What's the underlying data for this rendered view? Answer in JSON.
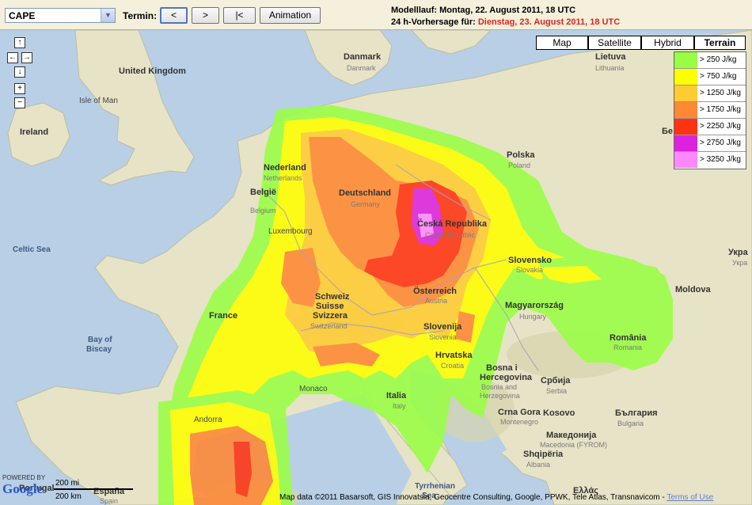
{
  "toolbar": {
    "parameter_select": "CAPE",
    "termin_label": "Termin:",
    "btn_prev": "<",
    "btn_next": ">",
    "btn_first": "|<",
    "btn_animation": "Animation",
    "modelllauf": "Modelllauf: Montag, 22. August 2011, 18 UTC",
    "vorhersage_prefix": "24 h-Vorhersage für:",
    "vorhersage_date": "Dienstag, 23. August 2011, 18 UTC"
  },
  "map_nav": {
    "up": "↑",
    "left": "←",
    "right": "→",
    "down": "↓",
    "zoom_in": "+",
    "zoom_out": "−"
  },
  "map_types": [
    "Map",
    "Satellite",
    "Hybrid",
    "Terrain"
  ],
  "selected_map_type": "Terrain",
  "legend": [
    {
      "label": "> 250 J/kg",
      "color": "#99ff44"
    },
    {
      "label": "> 750 J/kg",
      "color": "#ffff00"
    },
    {
      "label": "> 1250 J/kg",
      "color": "#ffcc33"
    },
    {
      "label": "> 1750 J/kg",
      "color": "#ff8833"
    },
    {
      "label": "> 2250 J/kg",
      "color": "#ff3311"
    },
    {
      "label": "> 2750 J/kg",
      "color": "#dd22dd"
    },
    {
      "label": "> 3250 J/kg",
      "color": "#ff88ff"
    }
  ],
  "places": [
    {
      "name": "Danmark",
      "sub": "Danmark",
      "kind": "country"
    },
    {
      "name": "United Kingdom",
      "kind": "country"
    },
    {
      "name": "Isle of Man",
      "kind": "small"
    },
    {
      "name": "Ireland",
      "kind": "country"
    },
    {
      "name": "Lietuva",
      "sub": "Lithuania",
      "kind": "country"
    },
    {
      "name": "Polska",
      "sub": "Poland",
      "kind": "country"
    },
    {
      "name": "Nederland",
      "sub": "Netherlands",
      "kind": "country"
    },
    {
      "name": "België",
      "sub": "Belgium",
      "kind": "country"
    },
    {
      "name": "Deutschland",
      "sub": "Germany",
      "kind": "country"
    },
    {
      "name": "Luxembourg",
      "kind": "small"
    },
    {
      "name": "Česká Republika",
      "sub": "Czech Republic",
      "kind": "country"
    },
    {
      "name": "Slovensko",
      "sub": "Slovakia",
      "kind": "country"
    },
    {
      "name": "Celtic Sea",
      "kind": "sea"
    },
    {
      "name": "France",
      "kind": "country"
    },
    {
      "name": "Schweiz",
      "kind": "country"
    },
    {
      "name": "Suisse",
      "kind": "country"
    },
    {
      "name": "Svizzera",
      "kind": "country"
    },
    {
      "name": "Switzerland",
      "kind": "sub"
    },
    {
      "name": "Österreich",
      "sub": "Austria",
      "kind": "country"
    },
    {
      "name": "Magyarország",
      "sub": "Hungary",
      "kind": "country"
    },
    {
      "name": "Moldova",
      "kind": "country"
    },
    {
      "name": "Bay of",
      "kind": "sea"
    },
    {
      "name": "Biscay",
      "kind": "sea"
    },
    {
      "name": "Slovenija",
      "sub": "Slovenia",
      "kind": "country"
    },
    {
      "name": "Hrvatska",
      "sub": "Croatia",
      "kind": "country"
    },
    {
      "name": "România",
      "sub": "Romania",
      "kind": "country"
    },
    {
      "name": "Bosna i",
      "kind": "country"
    },
    {
      "name": "Hercegovina",
      "kind": "country"
    },
    {
      "name": "Bosnia and",
      "kind": "sub"
    },
    {
      "name": "Herzegovina",
      "kind": "sub"
    },
    {
      "name": "Србија",
      "sub": "Serbia",
      "kind": "country"
    },
    {
      "name": "Monaco",
      "kind": "small"
    },
    {
      "name": "Italia",
      "sub": "Italy",
      "kind": "country"
    },
    {
      "name": "Andorra",
      "kind": "small"
    },
    {
      "name": "Crna Gora",
      "sub": "Montenegro",
      "kind": "country"
    },
    {
      "name": "Kosovo",
      "kind": "country"
    },
    {
      "name": "България",
      "sub": "Bulgaria",
      "kind": "country"
    },
    {
      "name": "Македонија",
      "sub": "Macedonia (FYROM)",
      "kind": "country"
    },
    {
      "name": "Shqipëria",
      "sub": "Albania",
      "kind": "country"
    },
    {
      "name": "Tyrrhenian",
      "kind": "sea"
    },
    {
      "name": "Sea",
      "kind": "sea"
    },
    {
      "name": "Ελλάς",
      "kind": "country"
    },
    {
      "name": "Укра",
      "kind": "country"
    },
    {
      "name": "Укра",
      "kind": "sub"
    },
    {
      "name": "Бе",
      "kind": "country"
    },
    {
      "name": "Portugal",
      "kind": "country"
    },
    {
      "name": "España",
      "sub": "Spain",
      "kind": "country"
    }
  ],
  "scale": {
    "mi": "200 mi",
    "km": "200 km"
  },
  "powered_by": "POWERED BY",
  "google_logo": "Google",
  "attribution": "Map data ©2011 Basarsoft, GIS Innovatsia, Geocentre Consulting, Google, PPWK, Tele Atlas, Transnavicom -",
  "terms": "Terms of Use"
}
